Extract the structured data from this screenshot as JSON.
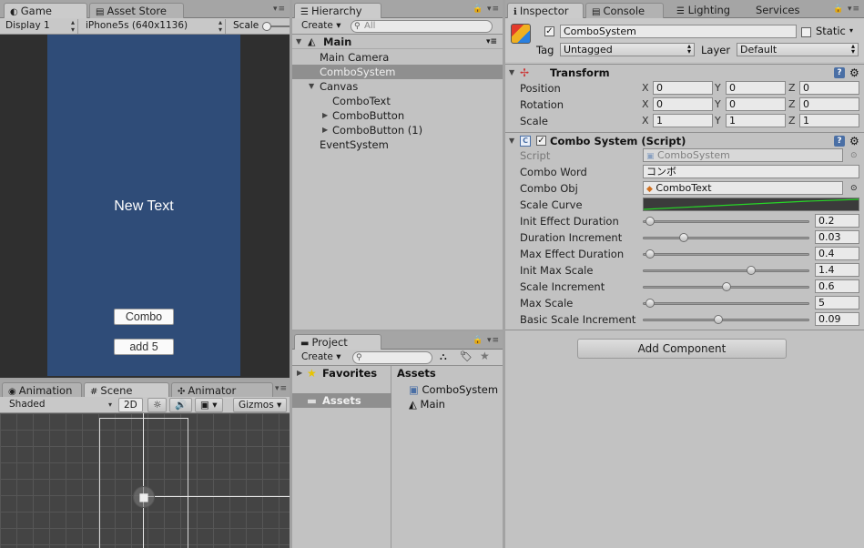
{
  "game_panel": {
    "tabs": [
      {
        "label": "Game"
      },
      {
        "label": "Asset Store"
      }
    ],
    "display": "Display 1",
    "resolution": "iPhone5s (640x1136)",
    "scale_label": "Scale",
    "screen": {
      "text": "New Text",
      "buttons": [
        "Combo",
        "add 5"
      ]
    }
  },
  "scene_panel": {
    "tabs": [
      {
        "label": "Animation"
      },
      {
        "label": "Scene"
      },
      {
        "label": "Animator"
      }
    ],
    "shading": "Shaded",
    "mode_2d": "2D",
    "gizmos": "Gizmos"
  },
  "hierarchy": {
    "tab": "Hierarchy",
    "create_label": "Create",
    "search_placeholder": "All",
    "scene_name": "Main",
    "items": [
      {
        "label": "Main Camera"
      },
      {
        "label": "ComboSystem"
      },
      {
        "label": "Canvas"
      },
      {
        "label": "ComboText"
      },
      {
        "label": "ComboButton"
      },
      {
        "label": "ComboButton (1)"
      },
      {
        "label": "EventSystem"
      }
    ]
  },
  "project": {
    "tab": "Project",
    "create_label": "Create",
    "favorites": "Favorites",
    "assets_folder": "Assets",
    "assets_header": "Assets",
    "files": [
      {
        "label": "ComboSystem"
      },
      {
        "label": "Main"
      }
    ]
  },
  "inspector": {
    "tabs": [
      {
        "label": "Inspector"
      },
      {
        "label": "Console"
      },
      {
        "label": "Lighting"
      },
      {
        "label": "Services"
      }
    ],
    "object_name": "ComboSystem",
    "static_label": "Static",
    "tag_label": "Tag",
    "tag_value": "Untagged",
    "layer_label": "Layer",
    "layer_value": "Default",
    "transform": {
      "title": "Transform",
      "rows": [
        {
          "label": "Position",
          "x": "0",
          "y": "0",
          "z": "0"
        },
        {
          "label": "Rotation",
          "x": "0",
          "y": "0",
          "z": "0"
        },
        {
          "label": "Scale",
          "x": "1",
          "y": "1",
          "z": "1"
        }
      ]
    },
    "script_component": {
      "title": "Combo System (Script)",
      "script_label": "Script",
      "script_value": "ComboSystem",
      "combo_word_label": "Combo Word",
      "combo_word_value": "コンボ",
      "combo_obj_label": "Combo Obj",
      "combo_obj_value": "ComboText",
      "scale_curve_label": "Scale Curve",
      "sliders": [
        {
          "label": "Init Effect Duration",
          "value": "0.2",
          "fraction": 0.02
        },
        {
          "label": "Duration Increment",
          "value": "0.03",
          "fraction": 0.23
        },
        {
          "label": "Max Effect Duration",
          "value": "0.4",
          "fraction": 0.02
        },
        {
          "label": "Init Max Scale",
          "value": "1.4",
          "fraction": 0.66
        },
        {
          "label": "Scale Increment",
          "value": "0.6",
          "fraction": 0.5
        },
        {
          "label": "Max Scale",
          "value": "5",
          "fraction": 0.02
        },
        {
          "label": "Basic Scale Increment",
          "value": "0.09",
          "fraction": 0.45
        }
      ]
    },
    "add_component": "Add Component"
  },
  "axis_labels": {
    "x": "X",
    "y": "Y",
    "z": "Z"
  },
  "colors": {
    "game_bg": "#2f4c78",
    "selection": "#8f8f8f",
    "curve": "#27d627"
  }
}
